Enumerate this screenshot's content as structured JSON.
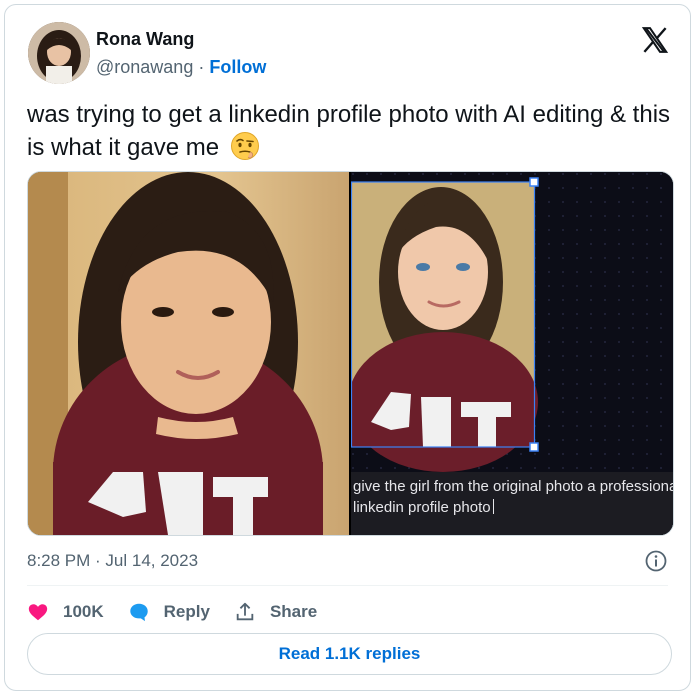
{
  "author": {
    "name": "Rona Wang",
    "handle": "@ronawang",
    "separator": "·",
    "follow_label": "Follow"
  },
  "icons": {
    "platform_logo": "x-logo-icon",
    "emoji": "face-with-raised-eyebrow-emoji",
    "info": "info-icon",
    "like": "heart-icon",
    "reply": "reply-bubble-icon",
    "share": "share-upload-icon"
  },
  "tweet": {
    "text": "was trying to get a linkedin profile photo with AI editing & this is what it gave me"
  },
  "media": {
    "caption_line1": "give the girl from the original photo a professiona",
    "caption_line2": "linkedin profile photo"
  },
  "meta": {
    "timestamp": "8:28 PM · Jul 14, 2023"
  },
  "actions": {
    "like_count": "100K",
    "reply_label": "Reply",
    "share_label": "Share"
  },
  "footer": {
    "read_replies_label": "Read 1.1K replies"
  },
  "colors": {
    "like": "#f91880",
    "reply": "#1d9bf0",
    "link": "#006fd6",
    "border": "#cfd9de"
  }
}
